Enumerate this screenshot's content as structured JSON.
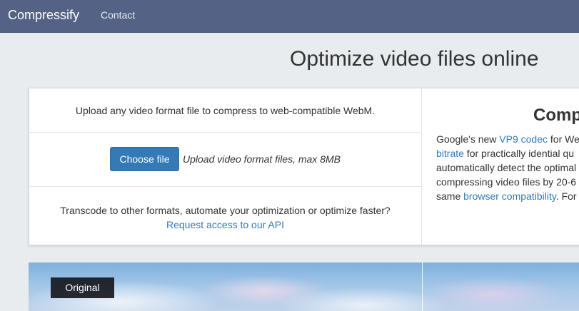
{
  "navbar": {
    "brand": "Compressify",
    "links": [
      "Contact"
    ]
  },
  "page_title": "Optimize video files online",
  "upload": {
    "intro": "Upload any video format file to compress to web-compatible WebM.",
    "choose_button": "Choose file",
    "hint": "Upload video format files, max 8MB",
    "api_text": "Transcode to other formats, automate your optimization or optimize faster?",
    "api_link": "Request access to our API"
  },
  "info": {
    "heading": "Comp",
    "line1_a": "Google's new ",
    "line1_link": "VP9 codec",
    "line1_b": " for We",
    "line2_link": "bitrate",
    "line2_b": " for practically idential qu",
    "line3": "automatically detect the optimal",
    "line4": "compressing video files by 20-6",
    "line5_a": "same ",
    "line5_link": "browser compatibility",
    "line5_b": ". For"
  },
  "preview": {
    "label": "Original"
  },
  "colors": {
    "navbar": "#546385",
    "primary": "#337ab7",
    "background": "#e9ecee"
  }
}
